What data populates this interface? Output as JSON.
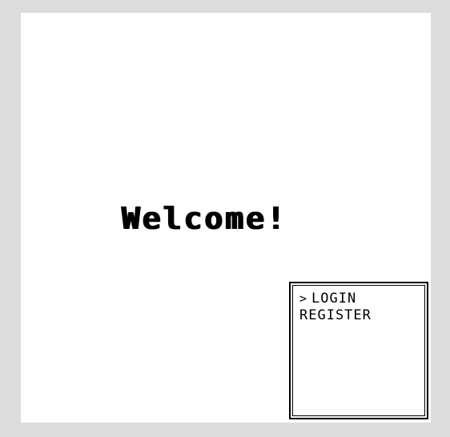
{
  "game": {
    "welcome_text": "Welcome!"
  },
  "menu": {
    "cursor_glyph": ">",
    "selected_index": 0,
    "items": [
      {
        "label": "LOGIN"
      },
      {
        "label": "REGISTER"
      }
    ]
  },
  "colors": {
    "background": "#dcdcdc",
    "screen": "#ffffff",
    "text": "#000000"
  }
}
